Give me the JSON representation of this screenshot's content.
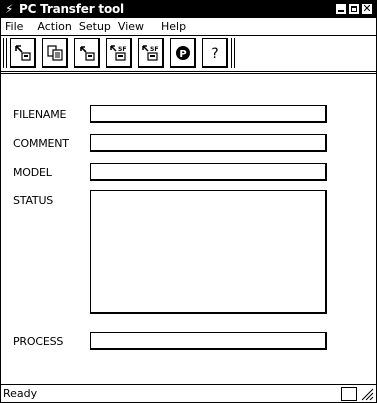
{
  "window": {
    "title": "PC Transfer tool",
    "title_icon": "lightning-bolt-icon"
  },
  "menu": [
    "File",
    "Action",
    "Setup",
    "View",
    "Help"
  ],
  "toolbar": {
    "buttons": [
      {
        "name": "download-to-pc-icon"
      },
      {
        "name": "copy-icon"
      },
      {
        "name": "upload-icon"
      },
      {
        "name": "download-sf-icon"
      },
      {
        "name": "upload-sf-icon"
      },
      {
        "name": "p-circle-icon"
      },
      {
        "name": "help-icon"
      }
    ]
  },
  "form": {
    "filename_label": "FILENAME",
    "filename_value": "",
    "comment_label": "COMMENT",
    "comment_value": "",
    "model_label": "MODEL",
    "model_value": "",
    "status_label": "STATUS",
    "status_value": "",
    "process_label": "PROCESS",
    "process_value": ""
  },
  "statusbar": {
    "text": "Ready"
  }
}
